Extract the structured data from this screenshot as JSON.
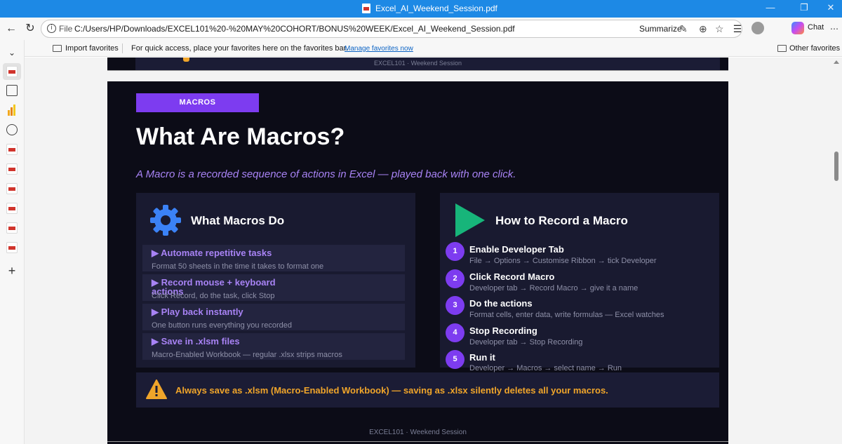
{
  "window": {
    "title": "Excel_AI_Weekend_Session.pdf",
    "controls": {
      "minimize": "—",
      "maximize": "❐",
      "close": "✕"
    }
  },
  "addressbar": {
    "back_icon": "back-arrow-icon",
    "refresh_icon": "refresh-icon",
    "scheme_label": "File",
    "url": "C:/Users/HP/Downloads/EXCEL101%20-%20MAY%20COHORT/BONUS%20WEEK/Excel_AI_Weekend_Session.pdf",
    "summarize_label": "Summarize",
    "chat_label": "Chat"
  },
  "favorites_bar": {
    "import_label": "Import favorites",
    "hint": "For quick access, place your favorites here on the favorites bar.",
    "manage_link": "Manage favorites now",
    "other_label": "Other favorites"
  },
  "pdf": {
    "prev_page_footer": "EXCEL101  ·  Weekend Session",
    "badge": "MACROS",
    "title": "What Are Macros?",
    "subtitle": "A Macro is a recorded sequence of actions in Excel — played back with one click.",
    "left_card": {
      "icon": "gear-icon",
      "title": "What Macros Do",
      "items": [
        {
          "heading": "▶ Automate repetitive tasks",
          "desc": "Format 50 sheets in the time it takes to format one"
        },
        {
          "heading": "▶ Record mouse + keyboard actions",
          "desc": "Click Record, do the task, click Stop"
        },
        {
          "heading": "▶ Play back instantly",
          "desc": "One button runs everything you recorded"
        },
        {
          "heading": "▶ Save in .xlsm files",
          "desc": "Macro-Enabled Workbook — regular .xlsx strips macros"
        }
      ]
    },
    "right_card": {
      "icon": "play-icon",
      "title": "How to Record a Macro",
      "steps": [
        {
          "num": "1",
          "title": "Enable Developer Tab",
          "desc": "File → Options → Customise Ribbon → tick Developer"
        },
        {
          "num": "2",
          "title": "Click Record Macro",
          "desc": "Developer tab → Record Macro → give it a name"
        },
        {
          "num": "3",
          "title": "Do the actions",
          "desc": "Format cells, enter data, write formulas — Excel watches"
        },
        {
          "num": "4",
          "title": "Stop Recording",
          "desc": "Developer tab → Stop Recording"
        },
        {
          "num": "5",
          "title": "Run it",
          "desc": "Developer → Macros → select name → Run"
        }
      ]
    },
    "alert": {
      "icon": "warning-icon",
      "text": "Always save as .xlsm (Macro-Enabled Workbook) — saving as .xlsx silently deletes all your macros."
    },
    "footer": "EXCEL101  ·  Weekend Session"
  },
  "colors": {
    "accent": "#7d3cf0",
    "lavender": "#a883f5",
    "warning": "#f0a52a",
    "slide_bg": "#0c0c17",
    "card_bg": "#191a30",
    "gear": "#3b82f6",
    "play": "#17b57a"
  }
}
